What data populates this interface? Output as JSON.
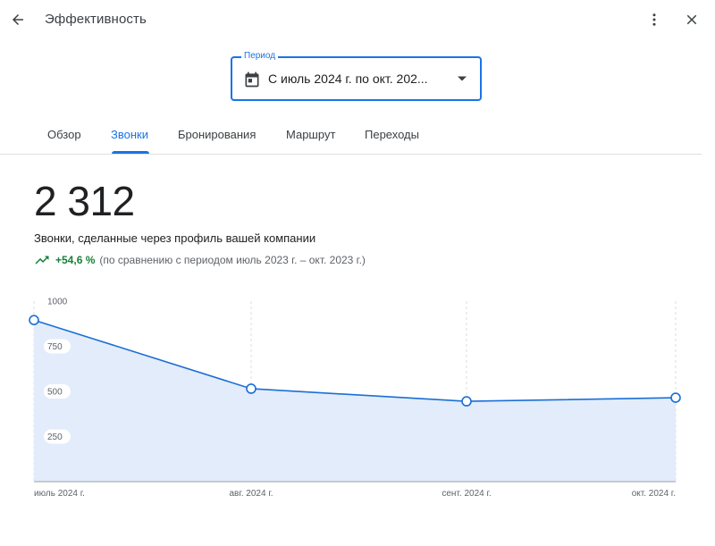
{
  "header": {
    "title": "Эффективность",
    "back_icon": "arrow-back-icon",
    "more_icon": "more-vert-icon",
    "close_icon": "close-icon"
  },
  "period_select": {
    "label": "Период",
    "value": "С июль 2024 г. по окт. 202...",
    "icon": "calendar-icon"
  },
  "tabs": [
    {
      "label": "Обзор",
      "active": false
    },
    {
      "label": "Звонки",
      "active": true
    },
    {
      "label": "Бронирования",
      "active": false
    },
    {
      "label": "Маршрут",
      "active": false
    },
    {
      "label": "Переходы",
      "active": false
    }
  ],
  "metric": {
    "value": "2 312",
    "description": "Звонки, сделанные через профиль вашей компании",
    "change": "+54,6 %",
    "comparison": "(по сравнению с периодом июль 2023 г. – окт. 2023 г.)",
    "trend_icon": "trending-up-icon"
  },
  "colors": {
    "accent": "#1a73e8",
    "positive": "#188038",
    "area_fill": "#e3ecfb",
    "line": "#1a6fd6"
  },
  "chart_data": {
    "type": "area",
    "x": [
      "июль 2024 г.",
      "авг. 2024 г.",
      "сент. 2024 г.",
      "окт. 2024 г."
    ],
    "series": [
      {
        "values": [
          895,
          515,
          445,
          465
        ]
      }
    ],
    "y_ticks": [
      {
        "value": 1000,
        "label": "1000"
      },
      {
        "value": 750,
        "label": "750"
      },
      {
        "value": 500,
        "label": "500"
      },
      {
        "value": 250,
        "label": "250"
      }
    ],
    "ylim": [
      0,
      1000
    ],
    "grid": "vertical dashed",
    "legend": "none",
    "title": "",
    "xlabel": "",
    "ylabel": ""
  }
}
